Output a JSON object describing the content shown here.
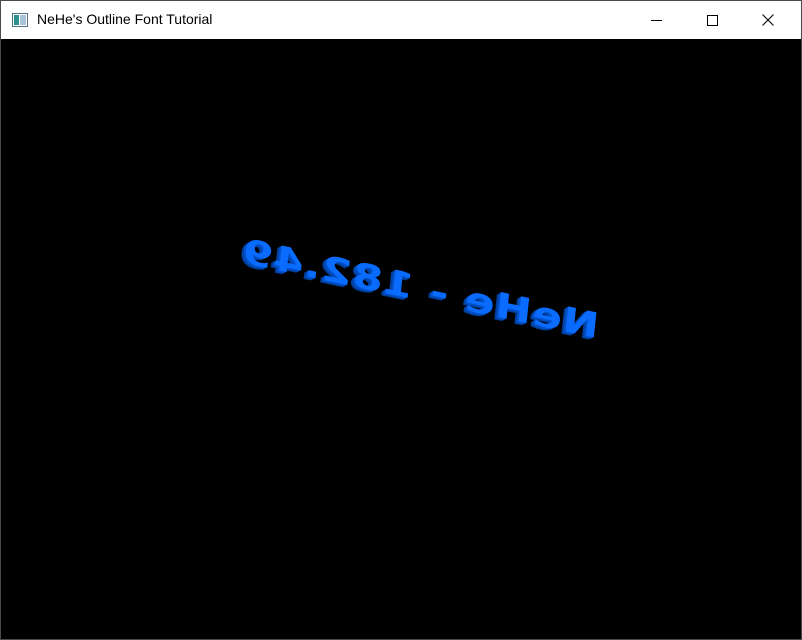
{
  "window": {
    "title": "NeHe's Outline Font Tutorial",
    "icon": "app-window-icon",
    "controls": {
      "minimize_icon": "minimize-icon",
      "maximize_icon": "maximize-icon",
      "close_icon": "close-icon"
    }
  },
  "viewport": {
    "background_color": "#000000",
    "rendered_text": "NeHe - 182.49",
    "text_color": "#0a6cff"
  }
}
